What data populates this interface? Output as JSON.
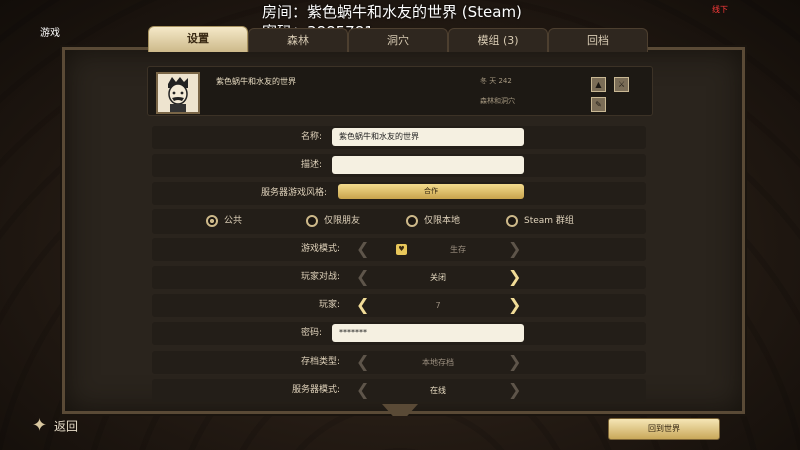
{
  "overlay": {
    "room": "房间：紫色蜗牛和水友的世界 (Steam)",
    "password": "密码：3885781",
    "top_left": "游戏",
    "top_right": "线下"
  },
  "tabs": [
    {
      "label": "设置",
      "active": true
    },
    {
      "label": "森林",
      "active": false
    },
    {
      "label": "洞穴",
      "active": false
    },
    {
      "label": "模组 (3)",
      "active": false
    },
    {
      "label": "回档",
      "active": false
    }
  ],
  "header": {
    "server_name": "紫色蜗牛和水友的世界",
    "days": "冬 天 242",
    "world_type": "森林和洞穴",
    "icons": [
      "survival-icon",
      "pvp-icon",
      "mod-icon"
    ]
  },
  "form": {
    "name_label": "名称:",
    "name_value": "紫色蜗牛和水友的世界",
    "desc_label": "描述:",
    "desc_value": "",
    "style_label": "服务器游戏风格:",
    "style_value": "合作",
    "privacy": [
      {
        "label": "公共",
        "selected": true
      },
      {
        "label": "仅限朋友",
        "selected": false
      },
      {
        "label": "仅限本地",
        "selected": false
      },
      {
        "label": "Steam 群组",
        "selected": false
      }
    ],
    "mode_label": "游戏模式:",
    "mode_value": "生存",
    "pvp_label": "玩家对战:",
    "pvp_value": "关闭",
    "players_label": "玩家:",
    "players_value": "7",
    "password_label": "密码:",
    "password_value": "*******",
    "save_label": "存档类型:",
    "save_value": "本地存档",
    "server_mode_label": "服务器模式:",
    "server_mode_value": "在线"
  },
  "footer": {
    "back_label": "返回",
    "return_label": "回到世界"
  },
  "colors": {
    "accent_gold": "#cdb98a",
    "panel_bg": "#2a241d"
  }
}
